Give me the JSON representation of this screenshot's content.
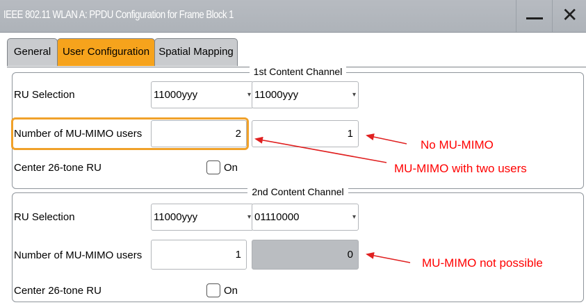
{
  "window": {
    "title": "IEEE 802.11 WLAN  A: PPDU Configuration for Frame Block 1",
    "minimize_icon": "minimize-icon",
    "close_icon": "close-icon",
    "close_glyph": "✕"
  },
  "tabs": [
    {
      "label": "General",
      "active": false
    },
    {
      "label": "User Configuration",
      "active": true
    },
    {
      "label": "Spatial Mapping",
      "active": false
    }
  ],
  "channels": [
    {
      "legend": "1st Content Channel",
      "ru_selection_label": "RU Selection",
      "ru_values": [
        "11000yyy",
        "11000yyy"
      ],
      "mimo_label": "Number of MU-MIMO users",
      "mimo_values": [
        "2",
        "1"
      ],
      "center_label": "Center 26-tone RU",
      "center_checkbox_label": "On",
      "center_checked": false
    },
    {
      "legend": "2nd Content Channel",
      "ru_selection_label": "RU Selection",
      "ru_values": [
        "11000yyy",
        "01110000"
      ],
      "mimo_label": "Number of MU-MIMO users",
      "mimo_values": [
        "1",
        "0"
      ],
      "center_label": "Center 26-tone RU",
      "center_checkbox_label": "On",
      "center_checked": false
    }
  ],
  "annotations": {
    "no_mimo": "No MU-MIMO",
    "two_users": "MU-MIMO with two users",
    "not_possible": "MU-MIMO not possible",
    "color": "#ff0000"
  },
  "colors": {
    "active_tab": "#f6a31c",
    "focus_outline": "#f0a12a",
    "titlebar": "#b2b6bc",
    "disabled_field": "#babdc1"
  }
}
